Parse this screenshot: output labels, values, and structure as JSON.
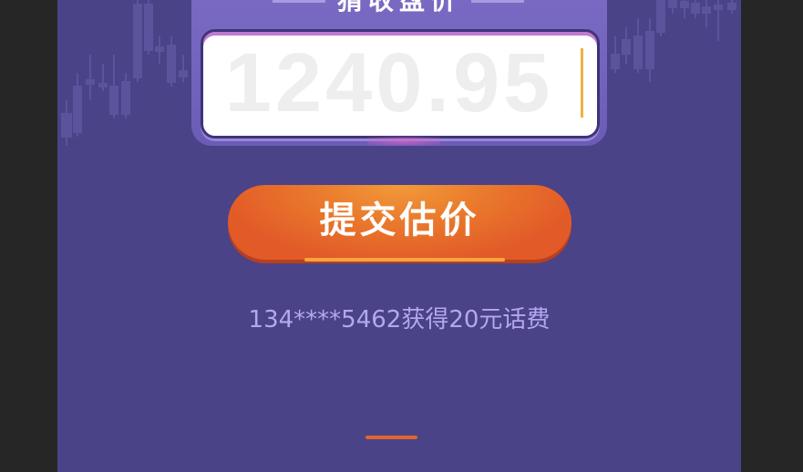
{
  "header": {
    "title": "猜收盘价"
  },
  "price_input": {
    "value": "1240.95"
  },
  "submit_button": {
    "label": "提交估价"
  },
  "notice": {
    "text": "134****5462获得20元话费"
  },
  "colors": {
    "background": "#4a4387",
    "card": "#6b5cb6",
    "button": "#e25a28",
    "accent": "#f0b040",
    "notice_text": "#b3a8ef"
  },
  "icons": [
    "candlestick-chart-decoration"
  ]
}
